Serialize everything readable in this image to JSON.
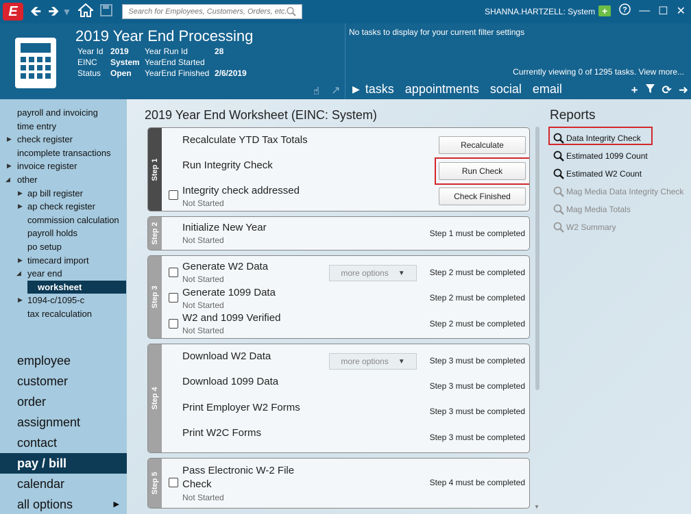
{
  "topbar": {
    "logo": "E",
    "search_placeholder": "Search for Employees, Customers, Orders, etc.",
    "user": "SHANNA.HARTZELL: System"
  },
  "header": {
    "title": "2019 Year End Processing",
    "meta": [
      {
        "k1": "Year Id",
        "v1": "2019",
        "k2": "Year Run Id",
        "v2": "28"
      },
      {
        "k1": "EINC",
        "v1": "System",
        "k2": "YearEnd Started",
        "v2": ""
      },
      {
        "k1": "Status",
        "v1": "Open",
        "k2": "YearEnd Finished",
        "v2": "2/6/2019"
      }
    ],
    "no_tasks": "No tasks to display for your current filter settings",
    "viewing": "Currently viewing 0 of 1295 tasks. View more...",
    "tabs": [
      "tasks",
      "appointments",
      "social",
      "email"
    ]
  },
  "sidebar": {
    "items": [
      {
        "label": "payroll and invoicing"
      },
      {
        "label": "time entry"
      },
      {
        "label": "check register"
      },
      {
        "label": "incomplete transactions"
      },
      {
        "label": "invoice register"
      },
      {
        "label": "other"
      },
      {
        "label": "ap bill register"
      },
      {
        "label": "ap check register"
      },
      {
        "label": "commission calculation"
      },
      {
        "label": "payroll holds"
      },
      {
        "label": "po setup"
      },
      {
        "label": "timecard import"
      },
      {
        "label": "year end"
      },
      {
        "label": "worksheet"
      },
      {
        "label": "1094-c/1095-c"
      },
      {
        "label": "tax recalculation"
      }
    ],
    "big": [
      "employee",
      "customer",
      "order",
      "assignment",
      "contact",
      "pay / bill",
      "calendar",
      "all options"
    ]
  },
  "main": {
    "title": "2019 Year End Worksheet (EINC: System)",
    "steps": [
      "Step 1",
      "Step 2",
      "Step 3",
      "Step 4",
      "Step 5"
    ],
    "step1": {
      "task1": "Recalculate YTD Tax Totals",
      "btn1": "Recalculate",
      "task2": "Run Integrity Check",
      "btn2": "Run Check",
      "task3": "Integrity check addressed",
      "task3_status": "Not Started",
      "btn3": "Check Finished"
    },
    "step2": {
      "task1": "Initialize New Year",
      "status": "Not Started",
      "req": "Step 1 must be completed"
    },
    "step3": {
      "task1": "Generate W2 Data",
      "status1": "Not Started",
      "task2": "Generate 1099 Data",
      "status2": "Not Started",
      "task3": "W2 and 1099 Verified",
      "status3": "Not Started",
      "req": "Step 2 must be completed",
      "more": "more options"
    },
    "step4": {
      "task1": "Download W2 Data",
      "task2": "Download 1099 Data",
      "task3": "Print Employer W2 Forms",
      "task4": "Print W2C Forms",
      "req": "Step 3 must be completed",
      "more": "more options"
    },
    "step5": {
      "task1a": "Pass Electronic W-2 File",
      "task1b": "Check",
      "status": "Not Started",
      "req": "Step 4 must be completed"
    }
  },
  "reports": {
    "title": "Reports",
    "items": [
      "Data Integrity Check",
      "Estimated 1099 Count",
      "Estimated W2 Count",
      "Mag Media Data Integrity Check",
      "Mag Media Totals",
      "W2 Summary"
    ]
  }
}
